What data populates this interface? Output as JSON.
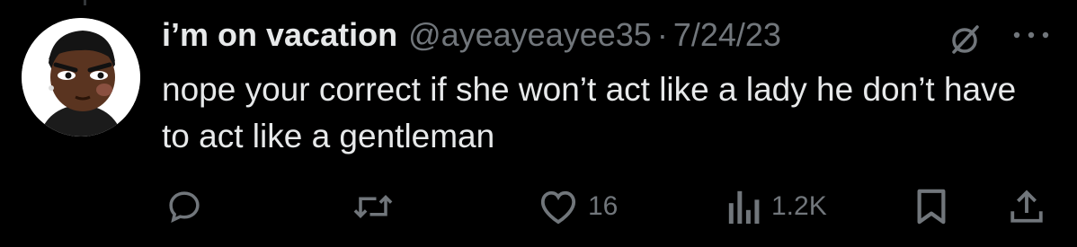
{
  "tweet": {
    "display_name": "i’m on vacation",
    "handle": "@ayeayeayee35",
    "separator": "·",
    "date": "7/24/23",
    "text": "nope your correct if she won’t act like a lady he don’t have to act like a gentleman"
  },
  "actions": {
    "reply": {
      "icon": "reply-icon",
      "count": ""
    },
    "retweet": {
      "icon": "retweet-icon",
      "count": ""
    },
    "like": {
      "icon": "heart-icon",
      "count": "16"
    },
    "views": {
      "icon": "views-icon",
      "count": "1.2K"
    },
    "bookmark": {
      "icon": "bookmark-icon"
    },
    "share": {
      "icon": "share-icon"
    }
  },
  "colors": {
    "background": "#000000",
    "primary_text": "#e7e9ea",
    "secondary_text": "#71767b"
  }
}
